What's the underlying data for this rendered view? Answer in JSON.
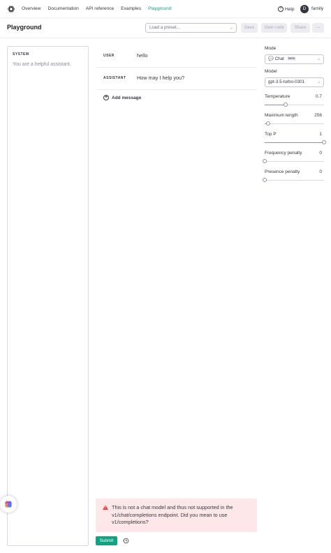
{
  "nav": {
    "links": [
      "Overview",
      "Documentation",
      "API reference",
      "Examples",
      "Playground"
    ],
    "active": "Playground",
    "help": "Help",
    "avatar_letter": "D",
    "org": "family"
  },
  "header": {
    "title": "Playground",
    "preset_placeholder": "Load a preset...",
    "save": "Save",
    "view_code": "View code",
    "share": "Share",
    "more": "···"
  },
  "system": {
    "label": "SYSTEM",
    "text": "You are a helpful assistant."
  },
  "messages": [
    {
      "role": "USER",
      "content": "hello"
    },
    {
      "role": "ASSISTANT",
      "content": "How may I help you?"
    }
  ],
  "add_message": "Add message",
  "alert": {
    "text": "This is not a chat model and thus not supported in the v1/chat/completions endpoint. Did you mean to use v1/completions?"
  },
  "submit": "Submit",
  "settings": {
    "mode_label": "Mode",
    "mode_value": "Chat",
    "mode_badge": "Beta",
    "model_label": "Model",
    "model_value": "gpt-3.5-turbo-0301",
    "params": [
      {
        "label": "Temperature",
        "value": "0.7",
        "fraction": 0.35
      },
      {
        "label": "Maximum length",
        "value": "256",
        "fraction": 0.06
      },
      {
        "label": "Top P",
        "value": "1",
        "fraction": 1.0
      },
      {
        "label": "Frequency penalty",
        "value": "0",
        "fraction": 0.0
      },
      {
        "label": "Presence penalty",
        "value": "0",
        "fraction": 0.0
      }
    ]
  },
  "colors": {
    "accent": "#10a37f",
    "error_bg": "#fde7e9",
    "error_icon": "#ef4146"
  }
}
